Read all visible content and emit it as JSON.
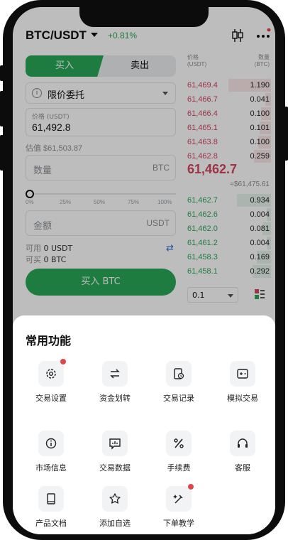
{
  "header": {
    "pair": "BTC/USDT",
    "change": "+0.81%"
  },
  "trade": {
    "buy_tab": "买入",
    "sell_tab": "卖出",
    "order_type": "限价委托",
    "price_label": "价格 (USDT)",
    "price_value": "61,492.8",
    "estimate": "估值 $61,503.87",
    "qty_placeholder": "数量",
    "qty_unit": "BTC",
    "slider_ticks": [
      "0%",
      "25%",
      "50%",
      "75%",
      "100%"
    ],
    "slider_value": 0,
    "amount_placeholder": "金额",
    "amount_unit": "USDT",
    "available_label": "可用",
    "available_value": "0 USDT",
    "can_buy_label": "可买",
    "can_buy_value": "0 BTC",
    "buy_button": "买入 BTC"
  },
  "orderbook": {
    "price_header": "价格",
    "price_unit": "(USDT)",
    "qty_header": "数量",
    "qty_unit": "(BTC)",
    "asks": [
      {
        "price": "61,469.4",
        "qty": "1.190"
      },
      {
        "price": "61,466.7",
        "qty": "0.041"
      },
      {
        "price": "61,466.4",
        "qty": "0.100"
      },
      {
        "price": "61,465.1",
        "qty": "0.101"
      },
      {
        "price": "61,463.8",
        "qty": "0.100"
      },
      {
        "price": "61,462.8",
        "qty": "0.259"
      }
    ],
    "last_price": "61,462.7",
    "mark_price": "≈$61,475.61",
    "bids": [
      {
        "price": "61,462.7",
        "qty": "0.934"
      },
      {
        "price": "61,462.6",
        "qty": "0.004"
      },
      {
        "price": "61,462.0",
        "qty": "0.081"
      },
      {
        "price": "61,461.2",
        "qty": "0.004"
      },
      {
        "price": "61,458.3",
        "qty": "0.169"
      },
      {
        "price": "61,458.1",
        "qty": "0.292"
      }
    ],
    "depth": "0.1"
  },
  "sheet": {
    "title": "常用功能",
    "items": [
      {
        "label": "交易设置",
        "icon": "gear-icon",
        "dot": true
      },
      {
        "label": "资金划转",
        "icon": "transfer-icon",
        "dot": false
      },
      {
        "label": "交易记录",
        "icon": "history-icon",
        "dot": false
      },
      {
        "label": "模拟交易",
        "icon": "gamepad-icon",
        "dot": false
      },
      {
        "label": "市场信息",
        "icon": "info-icon",
        "dot": false
      },
      {
        "label": "交易数据",
        "icon": "chart-icon",
        "dot": false
      },
      {
        "label": "手续费",
        "icon": "percent-icon",
        "dot": false
      },
      {
        "label": "客服",
        "icon": "headset-icon",
        "dot": false
      },
      {
        "label": "产品文档",
        "icon": "book-icon",
        "dot": false
      },
      {
        "label": "添加自选",
        "icon": "star-icon",
        "dot": false
      },
      {
        "label": "下单教学",
        "icon": "tutorial-icon",
        "dot": true
      }
    ]
  }
}
